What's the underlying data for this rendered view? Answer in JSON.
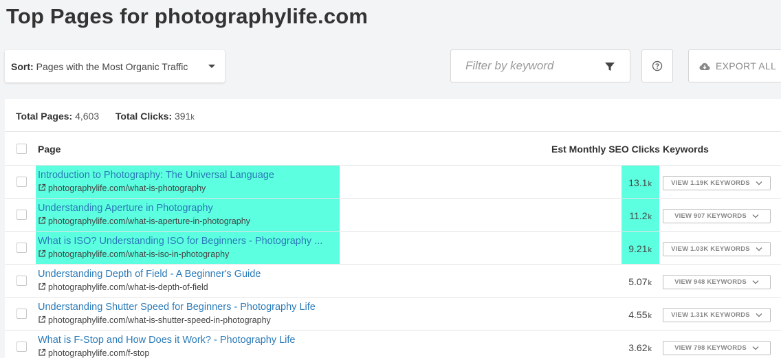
{
  "title": "Top Pages for photographylife.com",
  "toolbar": {
    "sort_label": "Sort:",
    "sort_value": "Pages with the Most Organic Traffic",
    "filter_placeholder": "Filter by keyword",
    "export_label": "EXPORT ALL"
  },
  "summary": {
    "total_pages_label": "Total Pages:",
    "total_pages_value": "4,603",
    "total_clicks_label": "Total Clicks:",
    "total_clicks_value": "391",
    "total_clicks_unit": "k"
  },
  "table": {
    "headers": {
      "page": "Page",
      "clicks": "Est Monthly SEO Clicks",
      "keywords": "Keywords"
    },
    "rows": [
      {
        "title": "Introduction to Photography: The Universal Language",
        "url": "photographylife.com/what-is-photography",
        "clicks": "13.1",
        "unit": "k",
        "keywords_button": "VIEW 1.19K KEYWORDS",
        "highlighted": true
      },
      {
        "title": "Understanding Aperture in Photography",
        "url": "photographylife.com/what-is-aperture-in-photography",
        "clicks": "11.2",
        "unit": "k",
        "keywords_button": "VIEW 907 KEYWORDS",
        "highlighted": true
      },
      {
        "title": "What is ISO? Understanding ISO for Beginners - Photography ...",
        "url": "photographylife.com/what-is-iso-in-photography",
        "clicks": "9.21",
        "unit": "k",
        "keywords_button": "VIEW 1.03K KEYWORDS",
        "highlighted": true
      },
      {
        "title": "Understanding Depth of Field - A Beginner's Guide",
        "url": "photographylife.com/what-is-depth-of-field",
        "clicks": "5.07",
        "unit": "k",
        "keywords_button": "VIEW 948 KEYWORDS",
        "highlighted": false
      },
      {
        "title": "Understanding Shutter Speed for Beginners - Photography Life",
        "url": "photographylife.com/what-is-shutter-speed-in-photography",
        "clicks": "4.55",
        "unit": "k",
        "keywords_button": "VIEW 1.31K KEYWORDS",
        "highlighted": false
      },
      {
        "title": "What is F-Stop and How Does it Work? - Photography Life",
        "url": "photographylife.com/f-stop",
        "clicks": "3.62",
        "unit": "k",
        "keywords_button": "VIEW 798 KEYWORDS",
        "highlighted": false
      }
    ]
  },
  "colors": {
    "highlight": "#5cffe0",
    "link": "#2a7ab8",
    "background": "#f3f4f6"
  },
  "icons": {
    "sort_caret": "caret-down-icon",
    "filter": "funnel-icon",
    "help": "question-circle-icon",
    "export": "cloud-download-icon",
    "external_link": "external-link-icon",
    "keywords_chevron": "chevron-down-icon"
  }
}
